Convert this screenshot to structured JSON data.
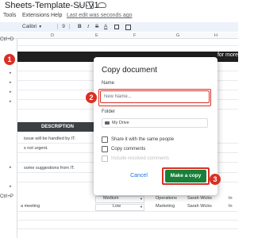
{
  "titlebar": {
    "doc_title": "Sheets-Template-SU-V1"
  },
  "menubar": {
    "items": [
      "Tools",
      "Extensions",
      "Help"
    ],
    "last_edit": "Last edit was seconds ago"
  },
  "toolbar": {
    "font": "Calibri",
    "size": "9",
    "bold": "B",
    "italic": "I",
    "strike": "S",
    "text_color": "A"
  },
  "columns": [
    "D",
    "E",
    "F",
    "G",
    "H"
  ],
  "leftstrip": {
    "shortcut_top": "Ctrl+D",
    "shortcut_bottom": "Ctrl+P"
  },
  "sheet": {
    "banner_text": "for more",
    "description_header": "DESCRIPTION",
    "rows": [
      "issue will be handled by IT.",
      "s not urgent.",
      "some suggestions from IT."
    ],
    "right_cells": [
      "In",
      "In",
      "In",
      "In",
      "In",
      "In",
      "In",
      "In",
      "In"
    ]
  },
  "bottom_rows": [
    {
      "priority": "Medium",
      "dept": "Operations",
      "person": "Sarah Wicks",
      "flag": "In"
    },
    {
      "desc": "a meeting",
      "priority": "Low",
      "dept": "Marketing",
      "person": "Sarah Wicks",
      "flag": "In"
    }
  ],
  "dialog": {
    "title": "Copy document",
    "name_label": "Name",
    "name_placeholder": "New Name...",
    "folder_label": "Folder",
    "folder_value": "My Drive",
    "options": [
      {
        "label": "Share it with the same people",
        "disabled": false
      },
      {
        "label": "Copy comments",
        "disabled": false
      },
      {
        "label": "Include resolved comments",
        "disabled": true
      }
    ],
    "cancel_label": "Cancel",
    "confirm_label": "Make a copy"
  },
  "steps": [
    "1",
    "2",
    "3"
  ],
  "colors": {
    "accent_red": "#d93025",
    "primary_green": "#188038",
    "link_blue": "#1a73e8"
  }
}
